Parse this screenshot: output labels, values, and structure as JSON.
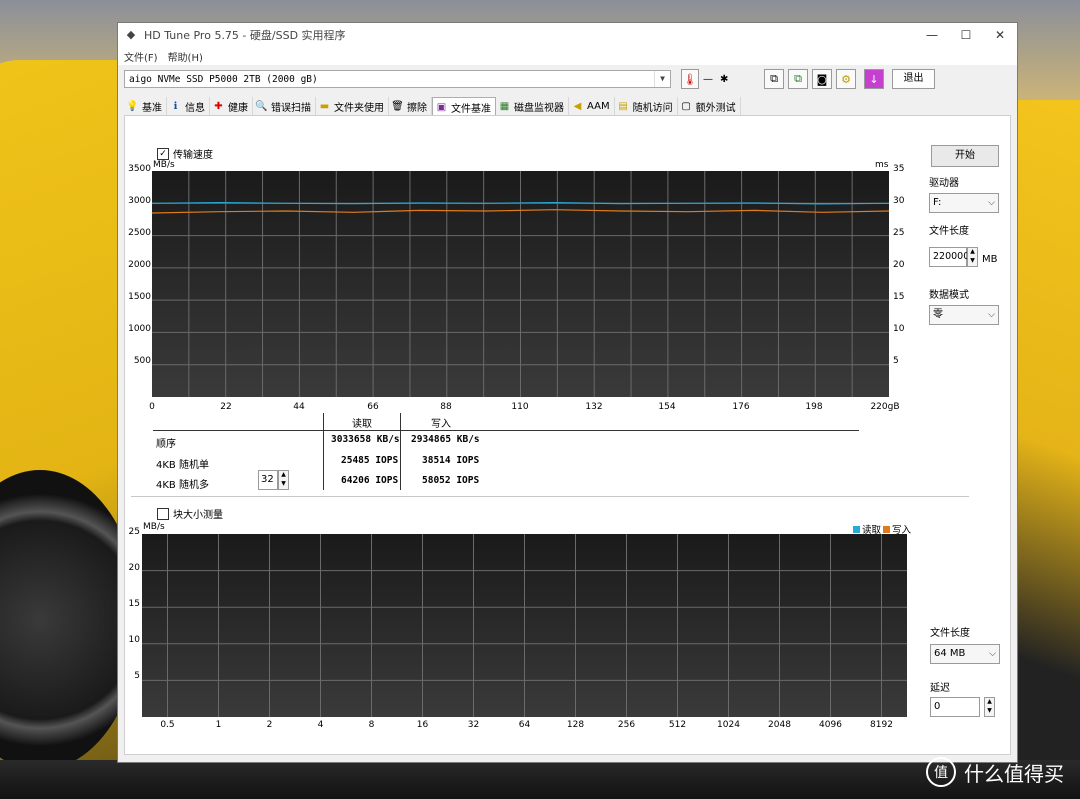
{
  "window": {
    "title": "HD Tune Pro 5.75 - 硬盘/SSD 实用程序",
    "controls": {
      "minimize": "—",
      "maximize": "☐",
      "close": "✕"
    }
  },
  "menu": {
    "file": "文件(F)",
    "help": "帮助(H)"
  },
  "toolbar": {
    "drive": "aigo NVMe SSD P5000 2TB (2000 gB)",
    "temperature": "— ",
    "exit_label": "退出"
  },
  "tabs": [
    {
      "label": "基准",
      "icon": "lightbulb-icon"
    },
    {
      "label": "信息",
      "icon": "info-icon"
    },
    {
      "label": "健康",
      "icon": "health-cross-icon"
    },
    {
      "label": "错误扫描",
      "icon": "magnifier-icon"
    },
    {
      "label": "文件夹使用",
      "icon": "folder-icon"
    },
    {
      "label": "擦除",
      "icon": "trash-icon"
    },
    {
      "label": "文件基准",
      "icon": "file-benchmark-icon"
    },
    {
      "label": "磁盘监视器",
      "icon": "monitor-icon"
    },
    {
      "label": "AAM",
      "icon": "speaker-icon"
    },
    {
      "label": "随机访问",
      "icon": "random-access-icon"
    },
    {
      "label": "额外测试",
      "icon": "extra-tests-icon"
    }
  ],
  "transfer": {
    "checkbox_label": "传输速度",
    "checked": true,
    "y_unit": "MB/s",
    "y2_unit": "ms",
    "y_ticks": [
      "3500",
      "3000",
      "2500",
      "2000",
      "1500",
      "1000",
      "500"
    ],
    "y2_ticks": [
      "35",
      "30",
      "25",
      "20",
      "15",
      "10",
      "5"
    ],
    "x_ticks": [
      "0",
      "22",
      "44",
      "66",
      "88",
      "110",
      "132",
      "154",
      "176",
      "198",
      "220gB"
    ]
  },
  "results": {
    "header_read": "读取",
    "header_write": "写入",
    "rows": [
      {
        "label": "顺序",
        "read": "3033658 KB/s",
        "write": "2934865 KB/s"
      },
      {
        "label": "4KB 随机单",
        "read": "25485 IOPS",
        "write": "38514 IOPS"
      },
      {
        "label": "4KB 随机多",
        "read": "64206 IOPS",
        "write": "58052 IOPS"
      }
    ],
    "queue_depth": "32"
  },
  "block": {
    "checkbox_label": "块大小测量",
    "checked": false,
    "y_unit": "MB/s",
    "y_ticks": [
      "25",
      "20",
      "15",
      "10",
      "5"
    ],
    "x_ticks": [
      "0.5",
      "1",
      "2",
      "4",
      "8",
      "16",
      "32",
      "64",
      "128",
      "256",
      "512",
      "1024",
      "2048",
      "4096",
      "8192"
    ],
    "legend_read": "读取",
    "legend_write": "写入"
  },
  "side": {
    "start_label": "开始",
    "drive_label": "驱动器",
    "drive_value": "F:",
    "file_length_label": "文件长度",
    "file_length_value": "220000",
    "file_length_unit": "MB",
    "data_mode_label": "数据模式",
    "data_mode_value": "零",
    "file_length2_label": "文件长度",
    "file_length2_value": "64 MB",
    "delay_label": "延迟",
    "delay_value": "0"
  },
  "colors": {
    "read": "#2aa8d8",
    "write": "#e07a1f",
    "graph_bg": "#222222",
    "grid": "#6a6a6a"
  },
  "chart_data": {
    "type": "line",
    "x_unit": "gB",
    "xlim": [
      0,
      220
    ],
    "ylim": [
      0,
      3500
    ],
    "ylabel": "MB/s",
    "series": [
      {
        "name": "读取",
        "x": [
          0,
          20,
          40,
          60,
          80,
          100,
          120,
          140,
          160,
          180,
          200,
          220
        ],
        "values": [
          3000,
          3010,
          3000,
          2995,
          3005,
          3000,
          3010,
          2995,
          3000,
          3005,
          2990,
          3000
        ]
      },
      {
        "name": "写入",
        "x": [
          0,
          20,
          40,
          60,
          80,
          100,
          120,
          140,
          160,
          180,
          200,
          220
        ],
        "values": [
          2850,
          2870,
          2880,
          2860,
          2890,
          2880,
          2900,
          2880,
          2870,
          2890,
          2860,
          2880
        ]
      }
    ]
  },
  "watermark": {
    "text": "什么值得买",
    "logo": "值"
  }
}
